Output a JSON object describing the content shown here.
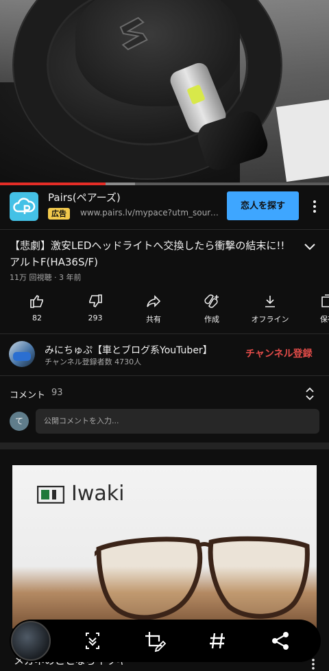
{
  "video": {
    "progress": 0.32,
    "buffered": 0.41
  },
  "ad": {
    "title": "Pairs(ペアーズ)",
    "badge": "広告",
    "url": "www.pairs.lv/mypace?utm_source=...",
    "cta": "恋人を探す",
    "logo_color": "#44c1e6",
    "cta_color": "#3ea6ff"
  },
  "video_info": {
    "title": "【悲劇】激安LEDヘッドライトへ交換したら衝撃の結末に!! アルトF(HA36S/F)",
    "meta": "11万 回視聴 · 3 年前"
  },
  "actions": [
    {
      "label": "82",
      "icon": "thumbs-up-icon"
    },
    {
      "label": "293",
      "icon": "thumbs-down-icon"
    },
    {
      "label": "共有",
      "icon": "share-icon"
    },
    {
      "label": "作成",
      "icon": "remix-icon"
    },
    {
      "label": "オフライン",
      "icon": "download-icon"
    },
    {
      "label": "保存",
      "icon": "save-icon"
    }
  ],
  "channel": {
    "name": "みにちゅぷ【車とブログ系YouTuber】",
    "subscribers": "チャンネル登録者数 4730人",
    "subscribe_label": "チャンネル登録",
    "subscribe_color": "#e34c49"
  },
  "comments": {
    "label": "コメント",
    "count": "93",
    "avatar_letter": "て",
    "placeholder": "公開コメントを入力..."
  },
  "promo": {
    "brand": "Iwaki",
    "title": "メガネのことならイワキ"
  },
  "toolbar": {
    "buttons": [
      "scroll-capture-icon",
      "crop-edit-icon",
      "hashtag-icon",
      "share-icon"
    ]
  },
  "colors": {
    "accent_red": "#e52d27",
    "background": "#0f0f0f"
  }
}
